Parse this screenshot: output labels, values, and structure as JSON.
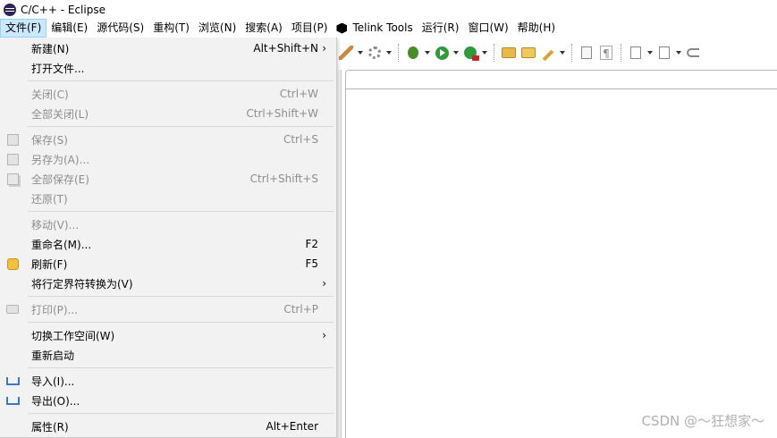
{
  "window": {
    "title": "C/C++  -  Eclipse"
  },
  "menubar": {
    "items": [
      {
        "label": "文件(F)",
        "active": true
      },
      {
        "label": "编辑(E)"
      },
      {
        "label": "源代码(S)"
      },
      {
        "label": "重构(T)"
      },
      {
        "label": "浏览(N)"
      },
      {
        "label": "搜索(A)"
      },
      {
        "label": "项目(P)"
      },
      {
        "label": "Telink Tools"
      },
      {
        "label": "运行(R)"
      },
      {
        "label": "窗口(W)"
      },
      {
        "label": "帮助(H)"
      }
    ]
  },
  "file_menu": {
    "items": [
      {
        "label": "新建(N)",
        "shortcut": "Alt+Shift+N",
        "submenu": true,
        "enabled": true
      },
      {
        "label": "打开文件...",
        "shortcut": "",
        "enabled": true
      },
      {
        "label": "关闭(C)",
        "shortcut": "Ctrl+W",
        "enabled": false
      },
      {
        "label": "全部关闭(L)",
        "shortcut": "Ctrl+Shift+W",
        "enabled": false
      },
      {
        "label": "保存(S)",
        "shortcut": "Ctrl+S",
        "enabled": false,
        "icon": "save-icon"
      },
      {
        "label": "另存为(A)...",
        "shortcut": "",
        "enabled": false,
        "icon": "save-as-icon"
      },
      {
        "label": "全部保存(E)",
        "shortcut": "Ctrl+Shift+S",
        "enabled": false,
        "icon": "save-all-icon"
      },
      {
        "label": "还原(T)",
        "shortcut": "",
        "enabled": false
      },
      {
        "label": "移动(V)...",
        "shortcut": "",
        "enabled": false
      },
      {
        "label": "重命名(M)...",
        "shortcut": "F2",
        "enabled": true
      },
      {
        "label": "刷新(F)",
        "shortcut": "F5",
        "enabled": true,
        "icon": "refresh-icon"
      },
      {
        "label": "将行定界符转换为(V)",
        "shortcut": "",
        "submenu": true,
        "enabled": true
      },
      {
        "label": "打印(P)...",
        "shortcut": "Ctrl+P",
        "enabled": false,
        "icon": "print-icon"
      },
      {
        "label": "切换工作空间(W)",
        "shortcut": "",
        "submenu": true,
        "enabled": true
      },
      {
        "label": "重新启动",
        "shortcut": "",
        "enabled": true
      },
      {
        "label": "导入(I)...",
        "shortcut": "",
        "enabled": true,
        "icon": "import-icon"
      },
      {
        "label": "导出(O)...",
        "shortcut": "",
        "enabled": true,
        "icon": "export-icon"
      },
      {
        "label": "属性(R)",
        "shortcut": "Alt+Enter",
        "enabled": true
      }
    ],
    "submenu_arrow": "›"
  },
  "watermark": "CSDN @～狂想家～"
}
